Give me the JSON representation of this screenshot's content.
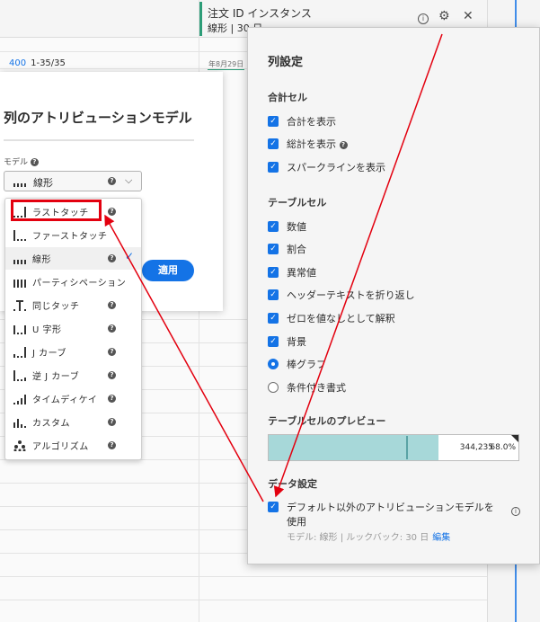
{
  "background": {
    "column_title": "注文 ID インスタンス",
    "column_subtitle": "線形 | 30 日",
    "row_count_num": "400",
    "row_count_range": "1-35/35",
    "date_chip": "年8月29日"
  },
  "modal": {
    "title": "列のアトリビューションモデル",
    "model_label": "モデル",
    "selected_model": "線形",
    "apply_label": "適用"
  },
  "dropdown": {
    "items": [
      {
        "label": "ラストタッチ",
        "icon": "last-touch-icon",
        "help": true
      },
      {
        "label": "ファーストタッチ",
        "icon": "first-touch-icon",
        "help": false
      },
      {
        "label": "線形",
        "icon": "linear-icon",
        "help": true,
        "selected": true
      },
      {
        "label": "パーティシペーション",
        "icon": "participation-icon",
        "help": false
      },
      {
        "label": "同じタッチ",
        "icon": "same-touch-icon",
        "help": true
      },
      {
        "label": "U 字形",
        "icon": "u-shaped-icon",
        "help": true
      },
      {
        "label": "J カーブ",
        "icon": "j-curve-icon",
        "help": true
      },
      {
        "label": "逆 J カーブ",
        "icon": "inverse-j-icon",
        "help": true
      },
      {
        "label": "タイムディケイ",
        "icon": "time-decay-icon",
        "help": true
      },
      {
        "label": "カスタム",
        "icon": "custom-icon",
        "help": true
      },
      {
        "label": "アルゴリズム",
        "icon": "algorithmic-icon",
        "help": true
      }
    ]
  },
  "panel": {
    "title": "列設定",
    "totals_section": "合計セル",
    "totals": [
      {
        "label": "合計を表示",
        "checked": true,
        "help": false
      },
      {
        "label": "総計を表示",
        "checked": true,
        "help": true
      },
      {
        "label": "スパークラインを表示",
        "checked": true,
        "help": false
      }
    ],
    "table_section": "テーブルセル",
    "table_cells": [
      {
        "label": "数値",
        "checked": true
      },
      {
        "label": "割合",
        "checked": true
      },
      {
        "label": "異常値",
        "checked": true
      },
      {
        "label": "ヘッダーテキストを折り返し",
        "checked": true
      },
      {
        "label": "ゼロを値なしとして解釈",
        "checked": true
      },
      {
        "label": "背景",
        "checked": true
      }
    ],
    "radios": [
      {
        "label": "棒グラフ",
        "selected": true
      },
      {
        "label": "条件付き書式",
        "selected": false
      }
    ],
    "preview_section": "テーブルセルのプレビュー",
    "preview_value": "344,235",
    "preview_percent": "68.0%",
    "preview_fill_fraction": 0.68,
    "data_section": "データ設定",
    "data_checkbox_line1": "デフォルト以外のアトリビューションモデルを",
    "data_checkbox_line2": "使用",
    "model_info": "モデル: 線形 | ルックバック: 30 日",
    "edit_label": "編集"
  },
  "colors": {
    "accent": "#1473e6",
    "annotation": "#e3000f",
    "bar_fill": "#a7d8d9"
  }
}
